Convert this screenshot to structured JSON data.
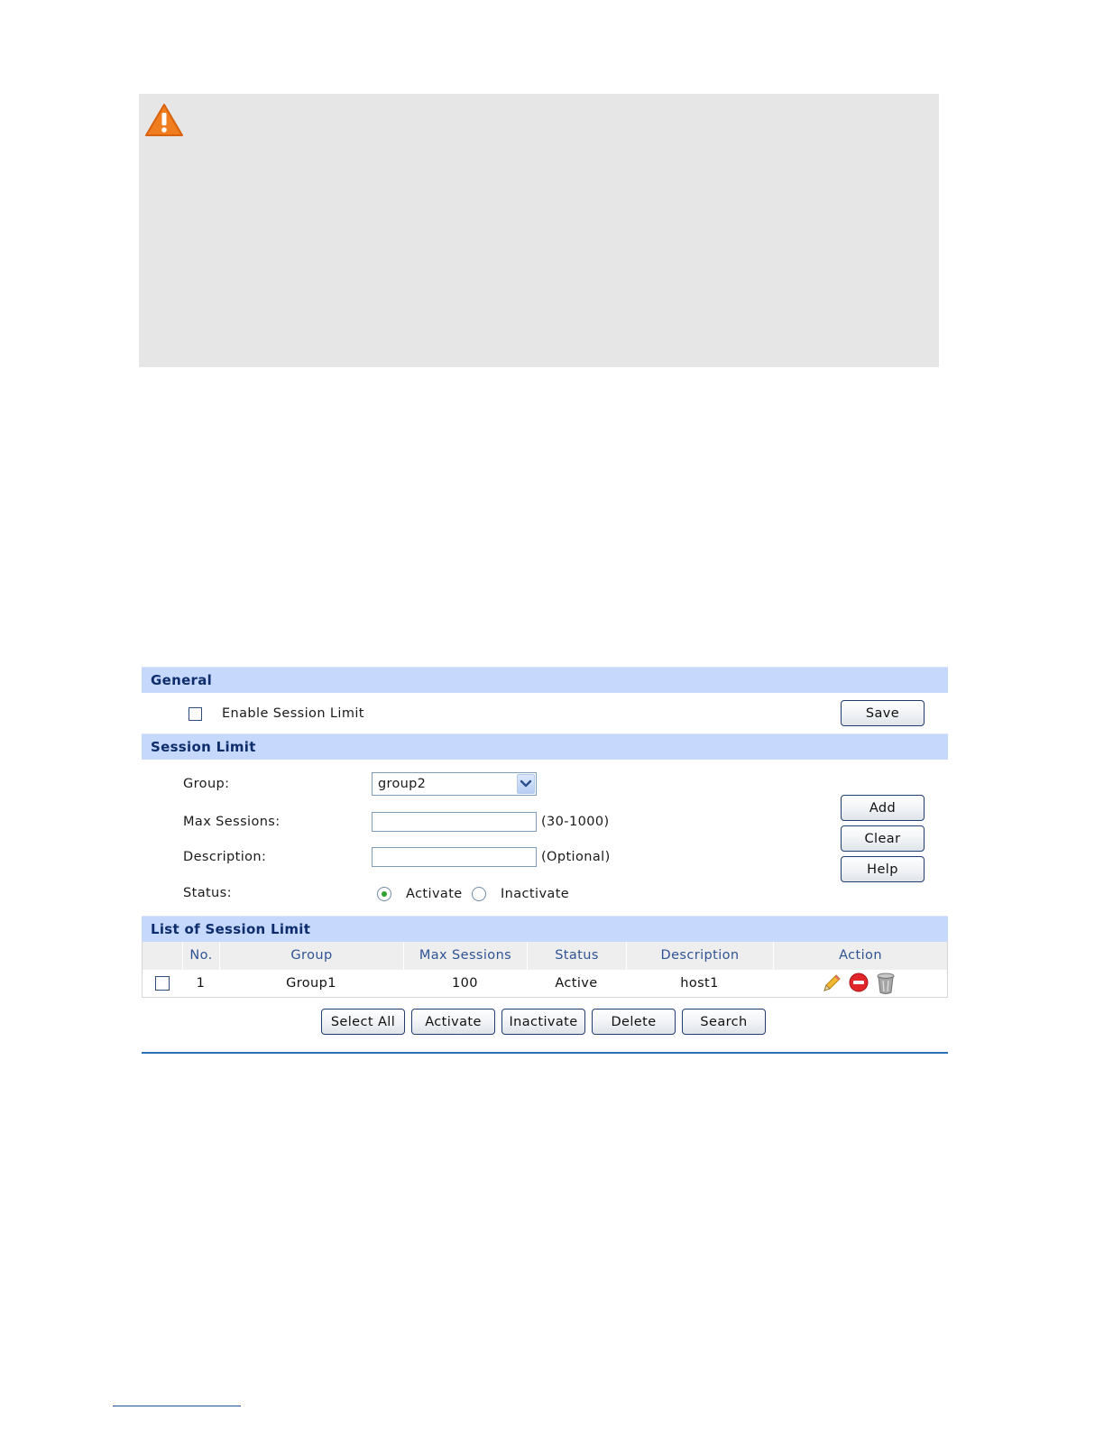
{
  "general": {
    "title": "General",
    "enable_label": "Enable Session Limit",
    "save_label": "Save"
  },
  "session_limit": {
    "title": "Session Limit",
    "group_label": "Group:",
    "group_value": "group2",
    "max_sessions_label": "Max Sessions:",
    "max_sessions_value": "",
    "max_sessions_hint": "(30-1000)",
    "description_label": "Description:",
    "description_value": "",
    "description_hint": "(Optional)",
    "status_label": "Status:",
    "status_options": [
      "Activate",
      "Inactivate"
    ],
    "status_selected": "Activate",
    "add_label": "Add",
    "clear_label": "Clear",
    "help_label": "Help"
  },
  "list": {
    "title": "List of Session Limit",
    "columns": [
      "No.",
      "Group",
      "Max Sessions",
      "Status",
      "Description",
      "Action"
    ],
    "rows": [
      {
        "no": "1",
        "group": "Group1",
        "max_sessions": "100",
        "status": "Active",
        "description": "host1",
        "actions": [
          "pencil-icon",
          "disable-icon",
          "trash-icon"
        ]
      }
    ],
    "buttons": [
      "Select All",
      "Activate",
      "Inactivate",
      "Delete",
      "Search"
    ]
  },
  "colors": {
    "section_header_bg": "#c6d8fb",
    "section_header_text": "#0e2d6d",
    "table_header_text": "#2f5495",
    "bottom_rule": "#2a6fb7",
    "warning_orange": "#f07d1f"
  }
}
